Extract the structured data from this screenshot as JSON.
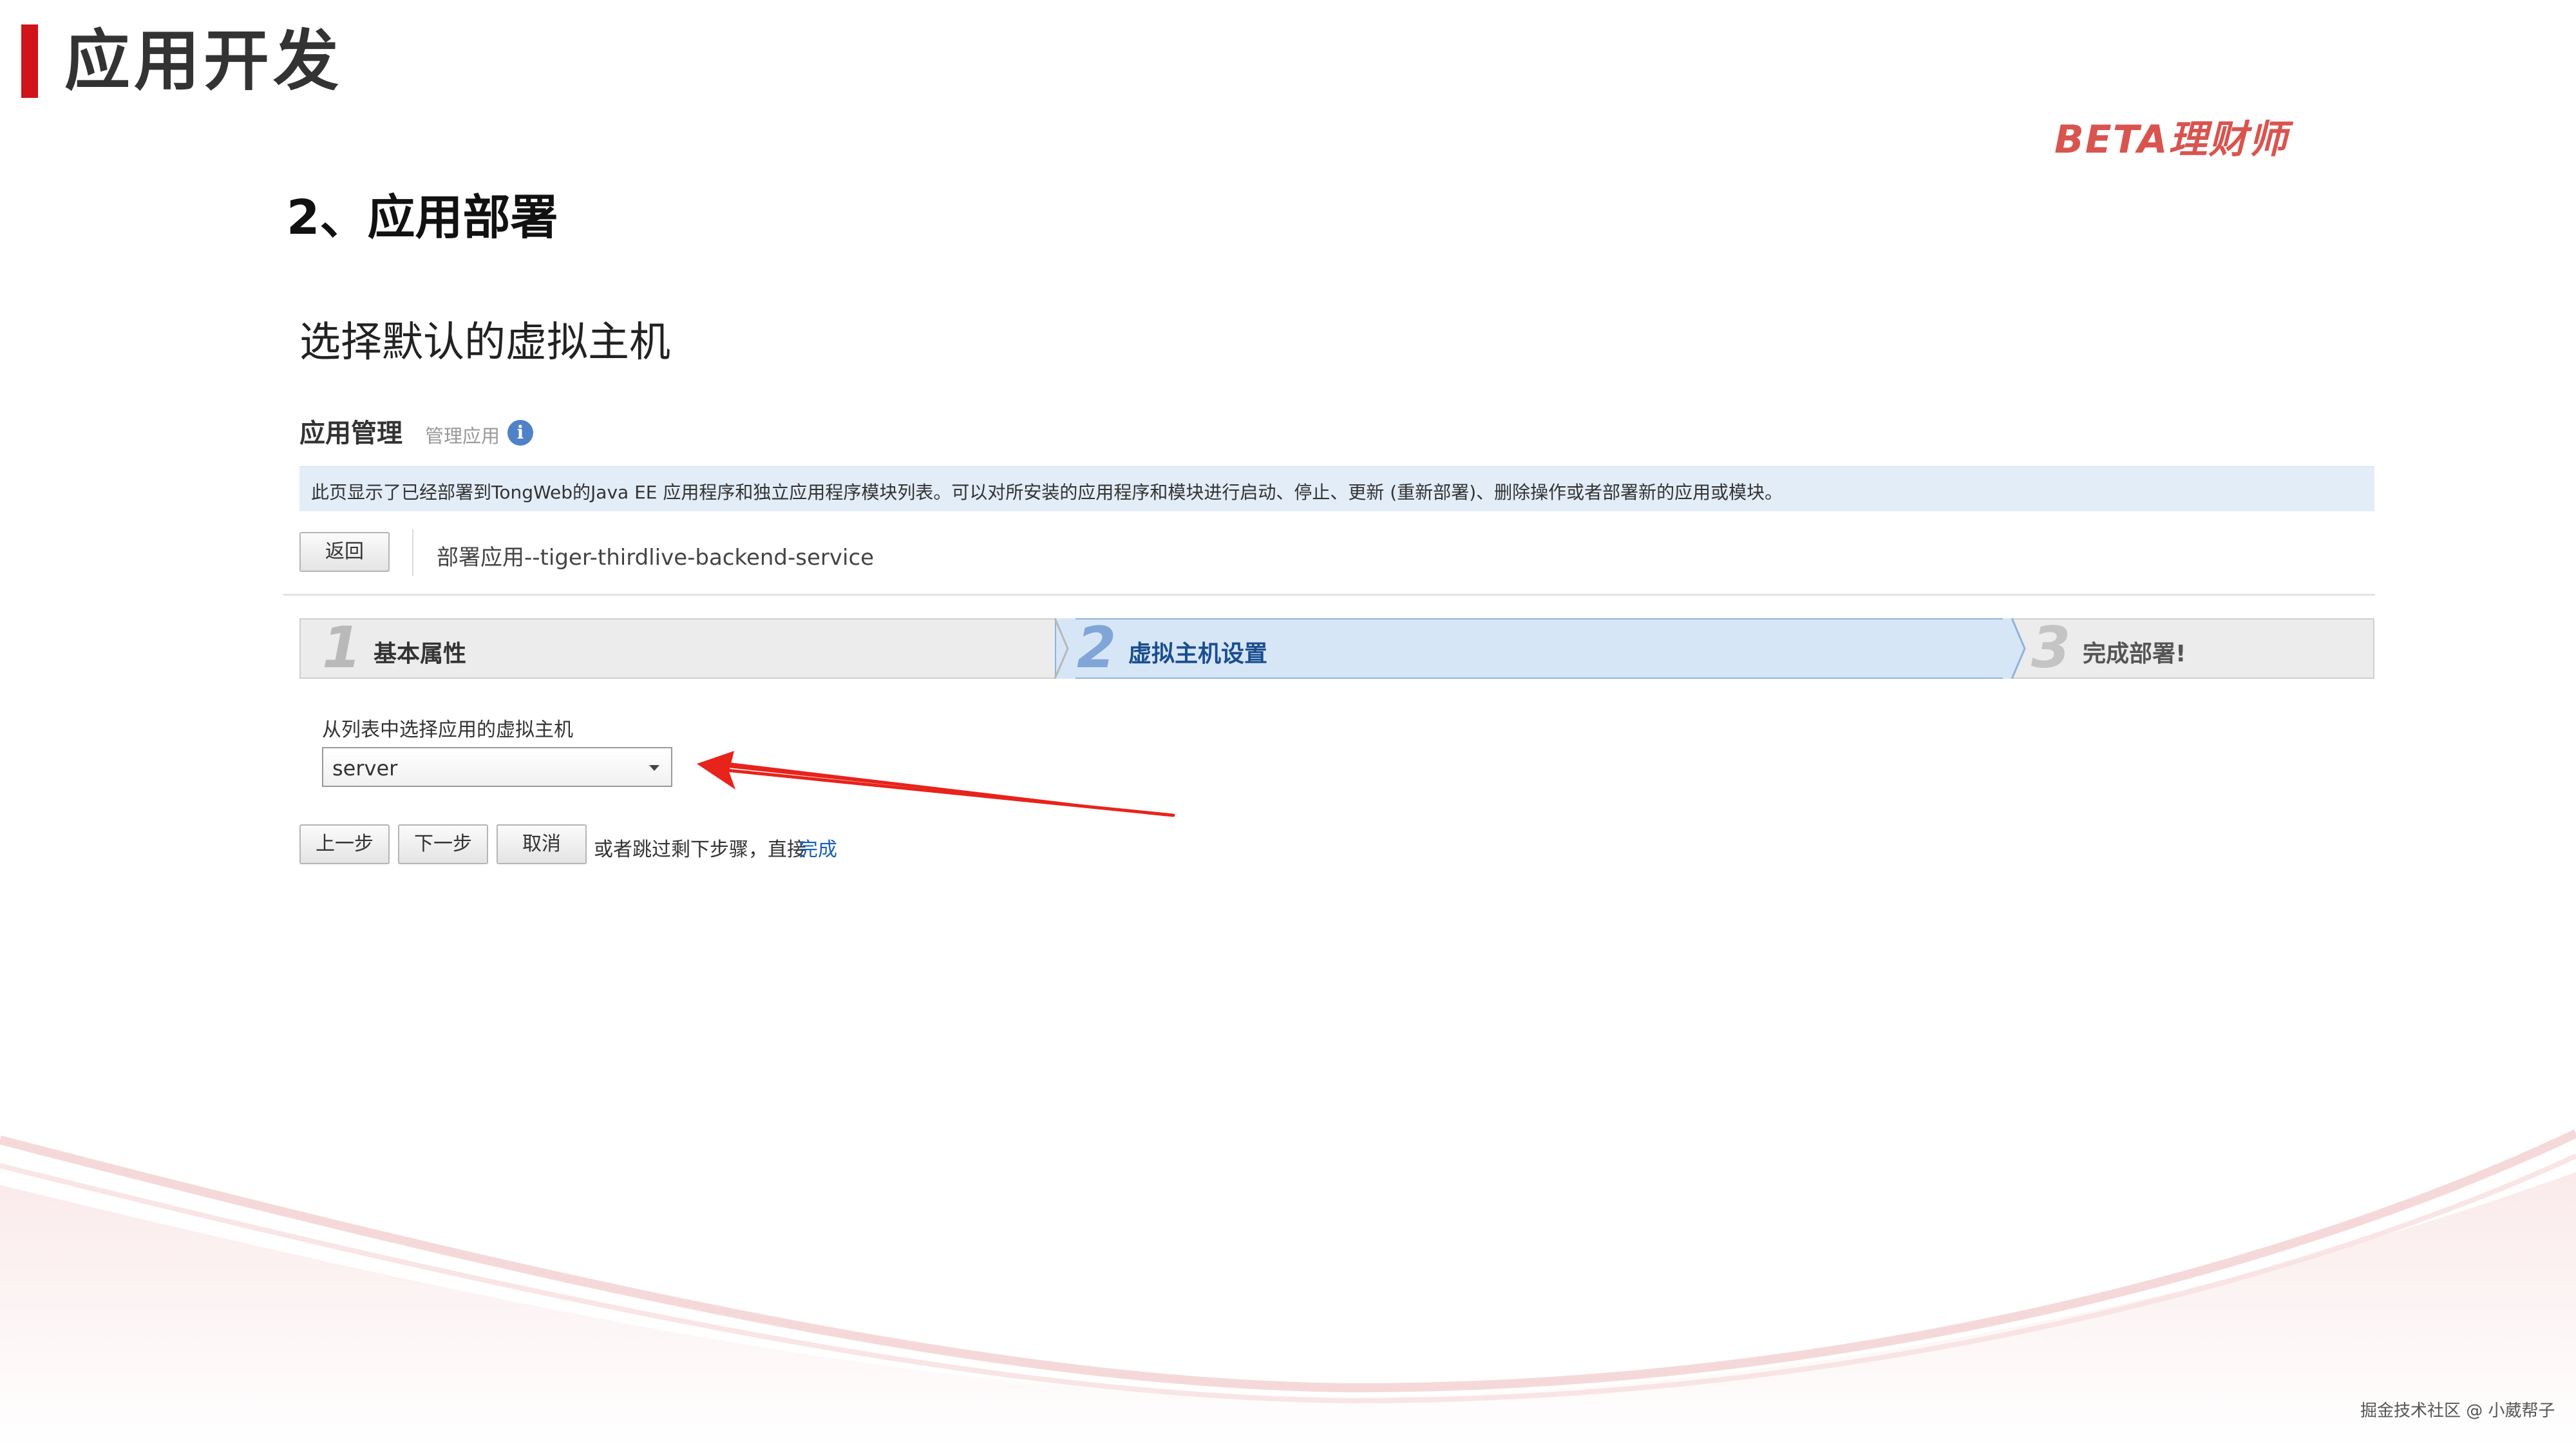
{
  "slide": {
    "title": "应用开发",
    "logo": "BETA理财师",
    "section": "2、应用部署",
    "subtitle": "选择默认的虚拟主机",
    "watermark": "掘金技术社区 @ 小葳帮子"
  },
  "app": {
    "heading": "应用管理",
    "subheading": "管理应用",
    "info_icon": "info-icon",
    "banner": "此页显示了已经部署到TongWeb的Java EE 应用程序和独立应用程序模块列表。可以对所安装的应用程序和模块进行启动、停止、更新 (重新部署)、删除操作或者部署新的应用或模块。",
    "back_button": "返回",
    "breadcrumb": "部署应用--tiger-thirdlive-backend-service"
  },
  "wizard": {
    "steps": [
      {
        "num": "1",
        "label": "基本属性"
      },
      {
        "num": "2",
        "label": "虚拟主机设置"
      },
      {
        "num": "3",
        "label": "完成部署!"
      }
    ],
    "active_step": 2
  },
  "form": {
    "field_label": "从列表中选择应用的虚拟主机",
    "selected_host": "server"
  },
  "actions": {
    "prev": "上一步",
    "next": "下一步",
    "cancel": "取消",
    "skip_text": "或者跳过剩下步骤，直接",
    "finish_link": "完成"
  },
  "colors": {
    "brand_red": "#d0141a",
    "active_step_bg": "#d7e6f7",
    "link_blue": "#1a5fb4",
    "annotation_arrow": "#e8231b"
  }
}
